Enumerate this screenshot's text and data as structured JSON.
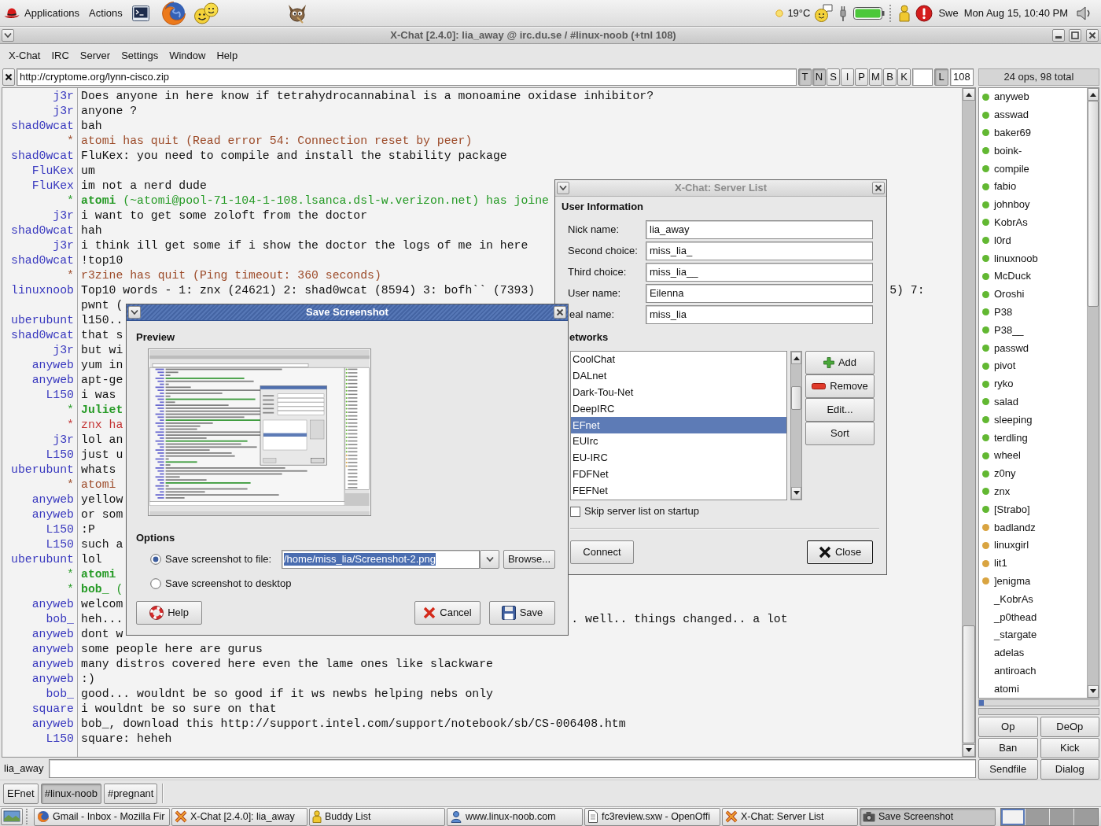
{
  "top_panel": {
    "menus": [
      "Applications",
      "Actions"
    ],
    "weather": "19°C",
    "keyboard_layout": "Swe",
    "clock": "Mon Aug 15, 10:40 PM"
  },
  "window": {
    "title": "X-Chat [2.4.0]: lia_away @ irc.du.se / #linux-noob (+tnl 108)"
  },
  "menu": [
    "X-Chat",
    "IRC",
    "Server",
    "Settings",
    "Window",
    "Help"
  ],
  "topic": {
    "text": "http://cryptome.org/lynn-cisco.zip",
    "modes": [
      {
        "label": "T",
        "on": true
      },
      {
        "label": "N",
        "on": true
      },
      {
        "label": "S",
        "on": false
      },
      {
        "label": "I",
        "on": false
      },
      {
        "label": "P",
        "on": false
      },
      {
        "label": "M",
        "on": false
      },
      {
        "label": "B",
        "on": false
      },
      {
        "label": "K",
        "on": false
      }
    ],
    "limit_toggle": {
      "label": "L",
      "on": true
    },
    "limit": "108"
  },
  "chat": {
    "lines": [
      {
        "nick": "j3r",
        "kind": "message",
        "text": "Does anyone in here know if tetrahydrocannabinal is a monoamine oxidase inhibitor?"
      },
      {
        "nick": "j3r",
        "kind": "message",
        "text": "anyone ?"
      },
      {
        "nick": "shad0wcat",
        "kind": "message",
        "text": "bah"
      },
      {
        "nick": "*",
        "kind": "quit",
        "text": "atomi has quit (Read error 54: Connection reset by peer)"
      },
      {
        "nick": "shad0wcat",
        "kind": "message",
        "text": "FluKex: you need to compile and install the stability package"
      },
      {
        "nick": "FluKex",
        "kind": "message",
        "text": "um"
      },
      {
        "nick": "FluKex",
        "kind": "message",
        "text": "im not a nerd dude"
      },
      {
        "nick": "*",
        "kind": "join",
        "who": "atomi",
        "text": "(~atomi@pool-71-104-1-108.lsanca.dsl-w.verizon.net) has joine"
      },
      {
        "nick": "j3r",
        "kind": "message",
        "text": "i want to get some zoloft from the doctor"
      },
      {
        "nick": "shad0wcat",
        "kind": "message",
        "text": "hah"
      },
      {
        "nick": "j3r",
        "kind": "message",
        "text": "i think ill get some if i show the doctor the logs of me in here"
      },
      {
        "nick": "shad0wcat",
        "kind": "message",
        "text": "!top10"
      },
      {
        "nick": "*",
        "kind": "quit",
        "text": "r3zine has quit (Ping timeout: 360 seconds)"
      },
      {
        "nick": "linuxnoob",
        "kind": "message",
        "text": "Top10 words - 1: znx (24621) 2: shad0wcat (8594) 3: bofh`` (7393)",
        "tail": "5) 7:"
      },
      {
        "kind": "message",
        "text": "pwnt ("
      },
      {
        "nick": "uberubunt",
        "kind": "message",
        "text": "l150.."
      },
      {
        "nick": "shad0wcat",
        "kind": "message",
        "text": "that s"
      },
      {
        "nick": "j3r",
        "kind": "message",
        "text": "but wi"
      },
      {
        "nick": "anyweb",
        "kind": "message",
        "text": "yum in"
      },
      {
        "nick": "anyweb",
        "kind": "message",
        "text": "apt-ge"
      },
      {
        "nick": "L150",
        "kind": "message",
        "text": "i was"
      },
      {
        "nick": "*",
        "kind": "join",
        "who": "Juliet"
      },
      {
        "nick": "*",
        "kind": "part",
        "text": "znx ha"
      },
      {
        "nick": "j3r",
        "kind": "message",
        "text": "lol an"
      },
      {
        "nick": "L150",
        "kind": "message",
        "text": "just u"
      },
      {
        "nick": "uberubunt",
        "kind": "message",
        "text": "whats"
      },
      {
        "nick": "*",
        "kind": "quit",
        "text": "atomi"
      },
      {
        "nick": "anyweb",
        "kind": "message",
        "text": "yellow"
      },
      {
        "nick": "anyweb",
        "kind": "message",
        "text": "or som"
      },
      {
        "nick": "L150",
        "kind": "message",
        "text": ":P"
      },
      {
        "nick": "L150",
        "kind": "message",
        "text": "such a"
      },
      {
        "nick": "uberubunt",
        "kind": "message",
        "text": "lol"
      },
      {
        "nick": "*",
        "kind": "join",
        "who": "atomi"
      },
      {
        "nick": "*",
        "kind": "join",
        "who": "bob_",
        "text": "("
      },
      {
        "nick": "anyweb",
        "kind": "message",
        "text": "welcom"
      },
      {
        "nick": "bob_",
        "kind": "message",
        "text": "heh...",
        "tail": ". well.. things changed.. a lot"
      },
      {
        "nick": "anyweb",
        "kind": "message",
        "text": "dont w"
      },
      {
        "nick": "anyweb",
        "kind": "message",
        "text": "some people here are gurus"
      },
      {
        "nick": "anyweb",
        "kind": "message",
        "text": "many distros covered here even the lame ones like slackware"
      },
      {
        "nick": "anyweb",
        "kind": "message",
        "text": ":)"
      },
      {
        "nick": "bob_",
        "kind": "message",
        "text": "good... wouldnt be so good if it ws newbs helping nebs only"
      },
      {
        "nick": "square",
        "kind": "message",
        "text": "i wouldnt be so sure on that"
      },
      {
        "nick": "anyweb",
        "kind": "message",
        "text": "bob_, download this http://support.intel.com/support/notebook/sb/CS-006408.htm"
      },
      {
        "nick": "L150",
        "kind": "message",
        "text": "square: heheh"
      }
    ]
  },
  "userlist": {
    "header": "24 ops, 98 total",
    "users": [
      {
        "name": "anyweb",
        "color": "#62b832"
      },
      {
        "name": "asswad",
        "color": "#62b832"
      },
      {
        "name": "baker69",
        "color": "#62b832"
      },
      {
        "name": "boink-",
        "color": "#62b832"
      },
      {
        "name": "compile",
        "color": "#62b832"
      },
      {
        "name": "fabio",
        "color": "#62b832"
      },
      {
        "name": "johnboy",
        "color": "#62b832"
      },
      {
        "name": "KobrAs",
        "color": "#62b832"
      },
      {
        "name": "l0rd",
        "color": "#62b832"
      },
      {
        "name": "linuxnoob",
        "color": "#62b832"
      },
      {
        "name": "McDuck",
        "color": "#62b832"
      },
      {
        "name": "Oroshi",
        "color": "#62b832"
      },
      {
        "name": "P38",
        "color": "#62b832"
      },
      {
        "name": "P38__",
        "color": "#62b832"
      },
      {
        "name": "passwd",
        "color": "#62b832"
      },
      {
        "name": "pivot",
        "color": "#62b832"
      },
      {
        "name": "ryko",
        "color": "#62b832"
      },
      {
        "name": "salad",
        "color": "#62b832"
      },
      {
        "name": "sleeping",
        "color": "#62b832"
      },
      {
        "name": "terdling",
        "color": "#62b832"
      },
      {
        "name": "wheel",
        "color": "#62b832"
      },
      {
        "name": "z0ny",
        "color": "#62b832"
      },
      {
        "name": "znx",
        "color": "#62b832"
      },
      {
        "name": "[Strabo]",
        "color": "#62b832"
      },
      {
        "name": "badlandz",
        "color": "#d9a441"
      },
      {
        "name": "linuxgirl",
        "color": "#d9a441"
      },
      {
        "name": "lit1",
        "color": "#d9a441"
      },
      {
        "name": "]enigma",
        "color": "#d9a441"
      },
      {
        "name": "_KobrAs"
      },
      {
        "name": "_p0thead"
      },
      {
        "name": "_stargate"
      },
      {
        "name": "adelas"
      },
      {
        "name": "antiroach"
      },
      {
        "name": "atomi"
      }
    ],
    "lag_meter": {
      "level": 0.04
    },
    "buttons": [
      "Op",
      "DeOp",
      "Ban",
      "Kick",
      "Sendfile",
      "Dialog"
    ]
  },
  "input": {
    "nick": "lia_away"
  },
  "tabs": [
    {
      "label": "EFnet",
      "selected": false
    },
    {
      "label": "#linux-noob",
      "selected": true
    },
    {
      "label": "#pregnant",
      "selected": false
    }
  ],
  "taskbar": {
    "tasks": [
      {
        "label": "Gmail - Inbox - Mozilla Fir",
        "kind": "browser",
        "selected": false
      },
      {
        "label": "X-Chat [2.4.0]: lia_away",
        "kind": "xchat",
        "selected": false
      },
      {
        "label": "Buddy List",
        "kind": "buddy",
        "selected": false
      },
      {
        "label": "www.linux-noob.com",
        "kind": "web",
        "selected": false
      },
      {
        "label": "fc3review.sxw - OpenOffi",
        "kind": "document",
        "selected": false
      },
      {
        "label": "X-Chat: Server List",
        "kind": "xchat",
        "selected": false
      },
      {
        "label": "Save Screenshot",
        "kind": "camera",
        "selected": true
      }
    ],
    "workspaces": [
      {
        "selected": true
      },
      {
        "selected": false
      },
      {
        "selected": false
      },
      {
        "selected": false
      }
    ]
  },
  "server_list_dialog": {
    "title": "X-Chat: Server List",
    "focused": false,
    "user_heading": "User Information",
    "fields": [
      {
        "label": "Nick name:",
        "value": "lia_away"
      },
      {
        "label": "Second choice:",
        "value": "miss_lia_"
      },
      {
        "label": "Third choice:",
        "value": "miss_lia__"
      },
      {
        "label": "User name:",
        "value": "Eilenna"
      },
      {
        "label": "eal name:",
        "value": "miss_lia"
      }
    ],
    "networks_heading": "etworks",
    "networks": [
      {
        "name": "CoolChat",
        "selected": false
      },
      {
        "name": "DALnet",
        "selected": false
      },
      {
        "name": "Dark-Tou-Net",
        "selected": false
      },
      {
        "name": "DeepIRC",
        "selected": false
      },
      {
        "name": "EFnet",
        "selected": true
      },
      {
        "name": "EUIrc",
        "selected": false
      },
      {
        "name": "EU-IRC",
        "selected": false
      },
      {
        "name": "FDFNet",
        "selected": false
      },
      {
        "name": "FEFNet",
        "selected": false
      }
    ],
    "network_buttons": [
      {
        "label": "Add",
        "kind": "add"
      },
      {
        "label": "Remove",
        "kind": "remove"
      },
      {
        "label": "Edit...",
        "kind": "plain"
      },
      {
        "label": "Sort",
        "kind": "plain"
      }
    ],
    "skip_option": {
      "label": "Skip server list on startup",
      "checked": false
    },
    "buttons": [
      {
        "label": "Connect",
        "kind": "plain"
      },
      {
        "label": "Close",
        "kind": "close"
      }
    ]
  },
  "save_screenshot_dialog": {
    "title": "Save Screenshot",
    "focused": true,
    "preview_heading": "Preview",
    "options_heading": "Options",
    "options": [
      {
        "label": "Save screenshot to file:",
        "kind": "file",
        "selected": true
      },
      {
        "label": "Save screenshot to desktop",
        "kind": "plain",
        "selected": false
      }
    ],
    "file_path": {
      "value": "/home/miss_lia/Screenshot-2.png",
      "selected": true
    },
    "browse_button": "Browse...",
    "buttons": [
      {
        "label": "Help",
        "kind": "help"
      },
      {
        "label": "Cancel",
        "kind": "cancel"
      },
      {
        "label": "Save",
        "kind": "save"
      }
    ]
  }
}
